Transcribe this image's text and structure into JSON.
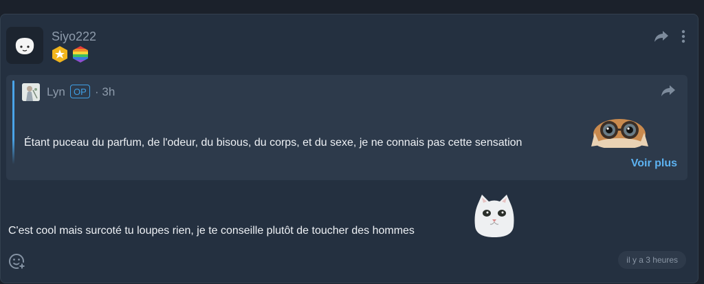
{
  "comment": {
    "username": "Siyo222",
    "body": "C'est cool mais surcoté tu loupes rien, je te conseille plutôt de toucher des hommes",
    "timestamp": "il y a 3 heures"
  },
  "quote": {
    "author": "Lyn",
    "op_label": "OP",
    "time": "· 3h",
    "text": "Étant puceau du parfum, de l'odeur, du bisous, du corps, et du sexe, je ne connais pas cette sensation",
    "more_label": "Voir plus"
  },
  "icons": {
    "share": "share-icon",
    "more": "more-vertical-icon",
    "emoji_add": "add-reaction-icon"
  },
  "colors": {
    "accent": "#5db3f2",
    "card_bg": "#243040",
    "quote_bg": "#2d3a4b"
  }
}
